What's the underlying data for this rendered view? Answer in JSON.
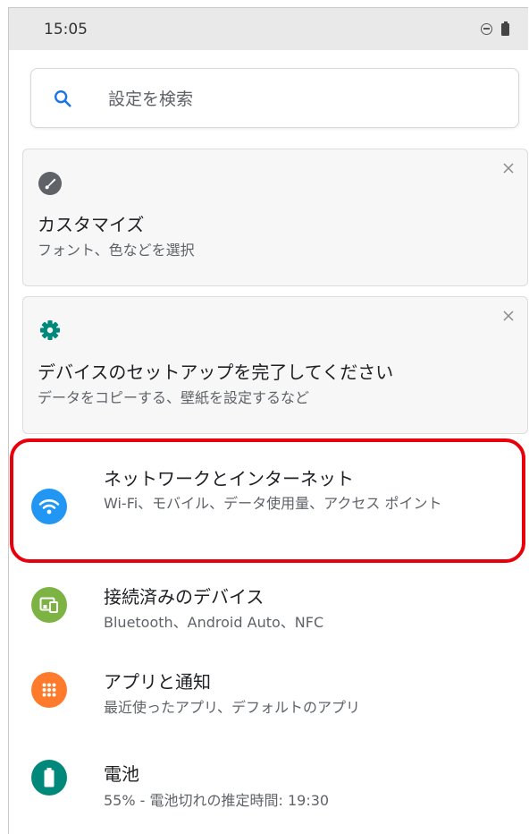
{
  "status_bar": {
    "time": "15:05",
    "icons": [
      "do-not-disturb-icon",
      "battery-icon"
    ]
  },
  "search": {
    "placeholder": "設定を検索",
    "icon": "search-icon"
  },
  "suggestions": [
    {
      "icon": "paintbrush-icon",
      "title": "カスタマイズ",
      "subtitle": "フォント、色などを選択",
      "close_icon": "close-icon"
    },
    {
      "icon": "gear-icon",
      "title": "デバイスのセットアップを完了してください",
      "subtitle": "データをコピーする、壁紙を設定するなど",
      "close_icon": "close-icon"
    }
  ],
  "settings": [
    {
      "icon": "wifi-icon",
      "icon_color": "#2196f3",
      "title": "ネットワークとインターネット",
      "subtitle": "Wi-Fi、モバイル、データ使用量、アクセス ポイント",
      "highlighted": true
    },
    {
      "icon": "connected-devices-icon",
      "icon_color": "#7cb342",
      "title": "接続済みのデバイス",
      "subtitle": "Bluetooth、Android Auto、NFC"
    },
    {
      "icon": "apps-grid-icon",
      "icon_color": "#ff7a2a",
      "title": "アプリと通知",
      "subtitle": "最近使ったアプリ、デフォルトのアプリ"
    },
    {
      "icon": "battery-icon",
      "icon_color": "#00897b",
      "title": "電池",
      "subtitle": "55% - 電池切れの推定時間: 19:30"
    }
  ],
  "colors": {
    "highlight": "#e8000b",
    "accent": "#1a73e8",
    "card_icon_dark": "#5f6368",
    "setup_gear": "#00897b"
  }
}
